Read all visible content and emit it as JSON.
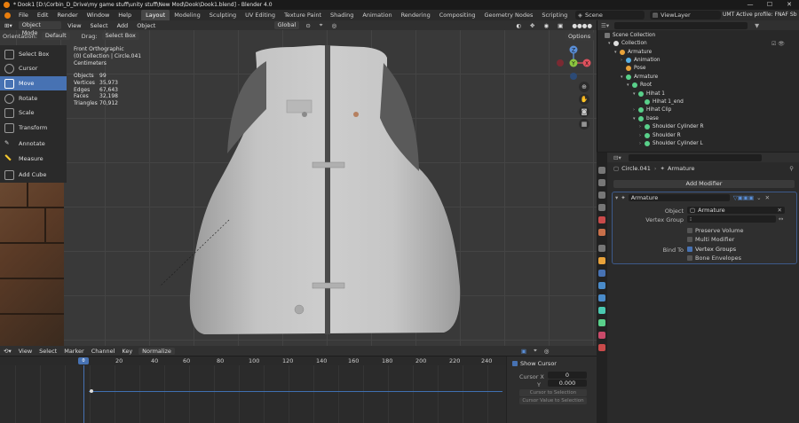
{
  "title_bar": {
    "text": "* Dook1 [D:\\Corbin_D_Drive\\my game stuff\\unity stuff\\New Mod\\Dook\\Dook1.blend] - Blender 4.0"
  },
  "window_controls": {
    "minimize": "—",
    "maximize": "☐",
    "close": "✕"
  },
  "menu": [
    "File",
    "Edit",
    "Render",
    "Window",
    "Help"
  ],
  "workspaces": [
    "Layout",
    "Modeling",
    "Sculpting",
    "UV Editing",
    "Texture Paint",
    "Shading",
    "Animation",
    "Rendering",
    "Compositing",
    "Geometry Nodes",
    "Scripting"
  ],
  "active_workspace": "Layout",
  "scene": "Scene",
  "view_layer": "ViewLayer",
  "profile": "UMT Active profile: FNAF Sb",
  "viewport_header": {
    "mode": "Object Mode",
    "menus": [
      "View",
      "Select",
      "Add",
      "Object"
    ],
    "transform_orientation": "Global",
    "options": "Options"
  },
  "viewport_header2": {
    "orientation_label": "Orientation:",
    "orientation_value": "Default",
    "drag_label": "Drag:",
    "drag_value": "Select Box"
  },
  "tools": [
    {
      "label": "Select Box",
      "active": false
    },
    {
      "label": "Cursor",
      "active": false
    },
    {
      "label": "Move",
      "active": true
    },
    {
      "label": "Rotate",
      "active": false
    },
    {
      "label": "Scale",
      "active": false
    },
    {
      "label": "Transform",
      "active": false
    },
    {
      "label": "Annotate",
      "active": false
    },
    {
      "label": "Measure",
      "active": false
    },
    {
      "label": "Add Cube",
      "active": false
    }
  ],
  "viewport_info": {
    "view": "Front Orthographic",
    "collection": "(0) Collection | Circle.041",
    "units": "Centimeters"
  },
  "stats": [
    {
      "k": "Objects",
      "v": "99"
    },
    {
      "k": "Vertices",
      "v": "35,973"
    },
    {
      "k": "Edges",
      "v": "67,643"
    },
    {
      "k": "Faces",
      "v": "32,198"
    },
    {
      "k": "Triangles",
      "v": "70,912"
    }
  ],
  "gizmo": {
    "x": "X",
    "y": "Y",
    "z": "Z"
  },
  "timeline": {
    "menus": [
      "View",
      "Select",
      "Marker",
      "Channel",
      "Key"
    ],
    "normalize": "Normalize",
    "ruler": [
      "20",
      "40",
      "60",
      "80",
      "100",
      "120",
      "140",
      "160",
      "180",
      "200",
      "220",
      "240"
    ],
    "current_frame": "0",
    "show_cursor": "Show Cursor",
    "cursor_x_label": "Cursor X",
    "cursor_x_value": "0",
    "cursor_y_label": "Y",
    "cursor_y_value": "0.000",
    "btn_cursor_to_selection": "Cursor to Selection",
    "btn_cursor_value_to_selection": "Cursor Value to Selection"
  },
  "outliner": {
    "header": "Scene Collection",
    "items": [
      {
        "label": "Collection",
        "indent": 0,
        "color": "#dddddd",
        "tri": "▾"
      },
      {
        "label": "Armature",
        "indent": 1,
        "color": "#e8a23a",
        "tri": "▾"
      },
      {
        "label": "Animation",
        "indent": 2,
        "color": "#59b0e3",
        "tri": "›"
      },
      {
        "label": "Pose",
        "indent": 2,
        "color": "#e8a23a",
        "tri": ""
      },
      {
        "label": "Armature",
        "indent": 2,
        "color": "#59d08a",
        "tri": "▾"
      },
      {
        "label": "Root",
        "indent": 3,
        "color": "#59d08a",
        "tri": "▾"
      },
      {
        "label": "Hihat 1",
        "indent": 4,
        "color": "#59d08a",
        "tri": "▾"
      },
      {
        "label": "Hihat 1_end",
        "indent": 5,
        "color": "#59d08a",
        "tri": ""
      },
      {
        "label": "Hihat Clip",
        "indent": 4,
        "color": "#59d08a",
        "tri": "›"
      },
      {
        "label": "base",
        "indent": 4,
        "color": "#59d08a",
        "tri": "▾"
      },
      {
        "label": "Shoulder Cylinder R",
        "indent": 5,
        "color": "#59d08a",
        "tri": "›"
      },
      {
        "label": "Shoulder R",
        "indent": 5,
        "color": "#59d08a",
        "tri": "›"
      },
      {
        "label": "Shoulder Cylinder L",
        "indent": 5,
        "color": "#59d08a",
        "tri": "›"
      }
    ]
  },
  "properties": {
    "breadcrumb_object": "Circle.041",
    "breadcrumb_sep": "›",
    "breadcrumb_data": "Armature",
    "add_modifier": "Add Modifier",
    "modifier_name": "Armature",
    "object_label": "Object",
    "object_value": "Armature",
    "vertex_group_label": "Vertex Group",
    "preserve_volume": "Preserve Volume",
    "multi_modifier": "Multi Modifier",
    "bind_to_label": "Bind To",
    "vertex_groups": "Vertex Groups",
    "bone_envelopes": "Bone Envelopes"
  }
}
